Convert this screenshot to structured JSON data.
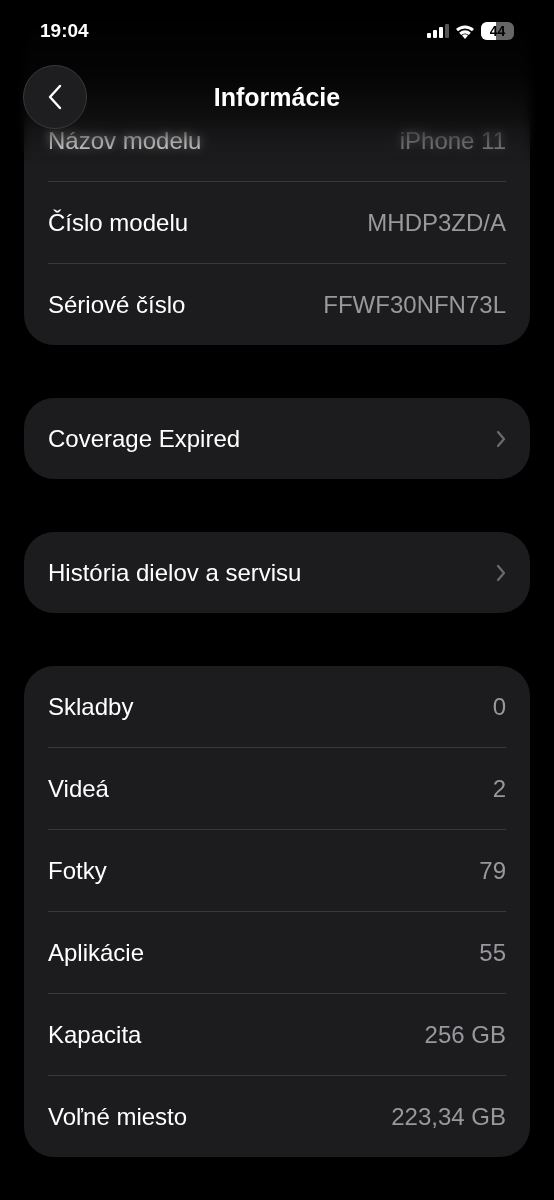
{
  "status_bar": {
    "time": "19:04",
    "battery": "44"
  },
  "nav": {
    "title": "Informácie"
  },
  "sections": [
    {
      "rows": [
        {
          "kind": "value",
          "label": "Názov modelu",
          "value": "iPhone 11"
        },
        {
          "kind": "value",
          "label": "Číslo modelu",
          "value": "MHDP3ZD/A"
        },
        {
          "kind": "value",
          "label": "Sériové číslo",
          "value": "FFWF30NFN73L"
        }
      ]
    },
    {
      "rows": [
        {
          "kind": "link",
          "label": "Coverage Expired"
        }
      ]
    },
    {
      "rows": [
        {
          "kind": "link",
          "label": "História dielov a servisu"
        }
      ]
    },
    {
      "rows": [
        {
          "kind": "value",
          "label": "Skladby",
          "value": "0"
        },
        {
          "kind": "value",
          "label": "Videá",
          "value": "2"
        },
        {
          "kind": "value",
          "label": "Fotky",
          "value": "79"
        },
        {
          "kind": "value",
          "label": "Aplikácie",
          "value": "55"
        },
        {
          "kind": "value",
          "label": "Kapacita",
          "value": "256 GB"
        },
        {
          "kind": "value",
          "label": "Voľné miesto",
          "value": "223,34 GB"
        }
      ]
    }
  ]
}
